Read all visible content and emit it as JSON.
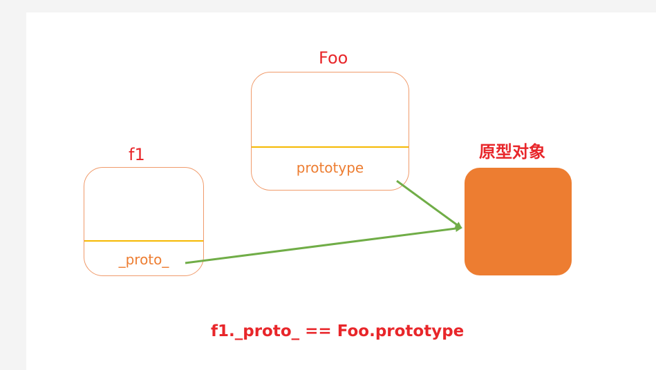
{
  "diagram": {
    "foo": {
      "label": "Foo",
      "field": "prototype"
    },
    "f1": {
      "label": "f1",
      "field": "_proto_"
    },
    "prototype_object": {
      "label": "原型对象"
    },
    "equation": "f1._proto_ == Foo.prototype",
    "colors": {
      "label_red": "#e8262a",
      "box_border": "#f09a6a",
      "divider": "#f5b800",
      "field_text": "#ed7d31",
      "object_fill": "#ed7d31",
      "arrow": "#70ad47"
    }
  }
}
